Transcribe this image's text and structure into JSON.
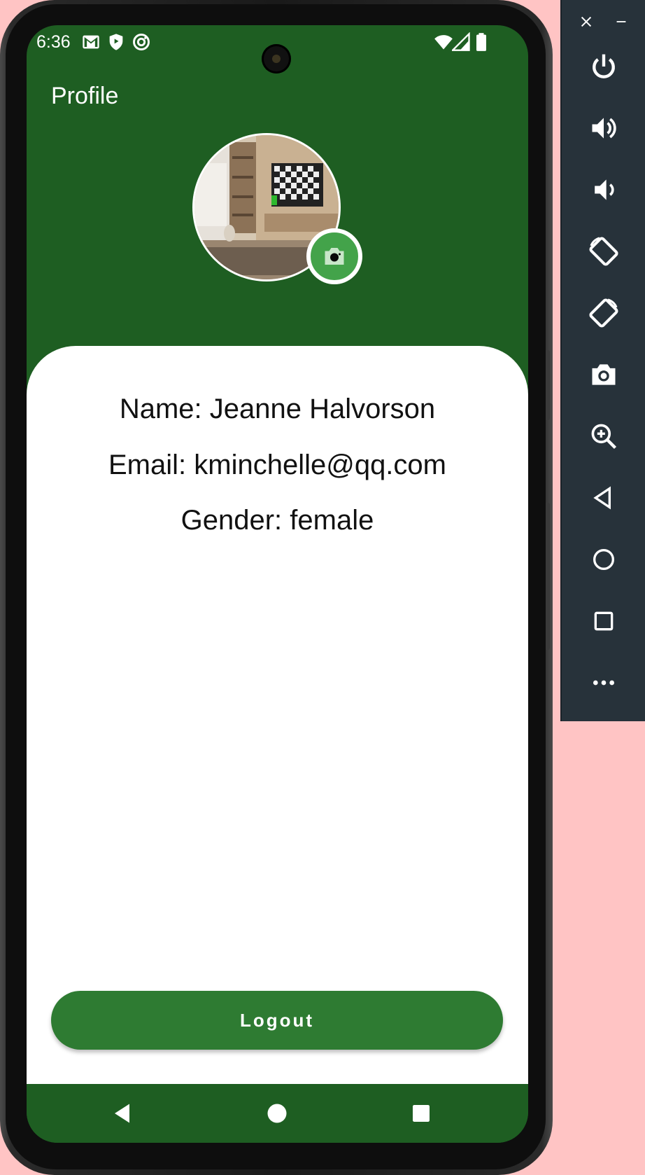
{
  "status_bar": {
    "time": "6:36",
    "icons": [
      "gmail-icon",
      "shield-icon",
      "at-sign-icon",
      "wifi-icon",
      "signal-icon",
      "battery-icon"
    ]
  },
  "app_bar": {
    "title": "Profile"
  },
  "profile": {
    "name_line": "Name: Jeanne Halvorson",
    "email_line": "Email: kminchelle@qq.com",
    "gender_line": "Gender: female"
  },
  "actions": {
    "logout_label": "Logout"
  },
  "colors": {
    "header_green": "#1e5e22",
    "button_green": "#2e7b32",
    "fab_green": "#43a34a",
    "panel_bg": "#27323a",
    "backdrop": "#ffc4c4"
  },
  "emulator_panel": {
    "window_controls": [
      "close-icon",
      "minimize-icon"
    ],
    "tools": [
      "power-icon",
      "volume-up-icon",
      "volume-down-icon",
      "rotate-left-icon",
      "rotate-right-icon",
      "screenshot-icon",
      "zoom-icon",
      "back-icon",
      "home-icon",
      "overview-icon",
      "more-icon"
    ]
  }
}
